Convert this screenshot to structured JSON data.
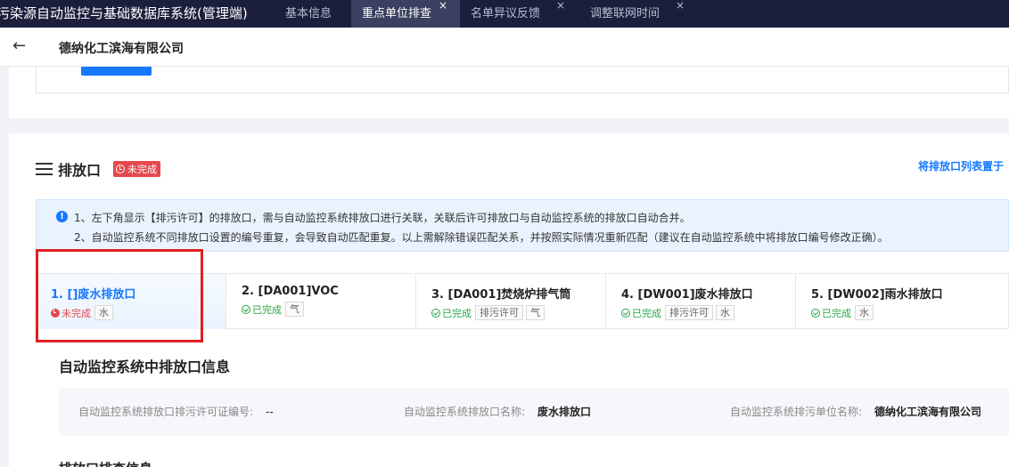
{
  "app": {
    "title": "污染源自动监控与基础数据库系统(管理端)"
  },
  "tabs": [
    {
      "label": "基本信息",
      "closable": false,
      "active": false
    },
    {
      "label": "重点单位排查",
      "closable": true,
      "active": true
    },
    {
      "label": "名单异议反馈",
      "closable": true,
      "active": false
    },
    {
      "label": "调整联网时间",
      "closable": true,
      "active": false
    }
  ],
  "header": {
    "back_icon": "arrow-left-icon",
    "company": "德纳化工滨海有限公司"
  },
  "section": {
    "title": "排放口",
    "status": "未完成",
    "top_link": "将排放口列表置于"
  },
  "notice": {
    "line1": "1、左下角显示【排污许可】的排放口，需与自动监控系统排放口进行关联，关联后许可排放口与自动监控系统的排放口自动合并。",
    "line2": "2、自动监控系统不同排放口设置的编号重复，会导致自动匹配重复。以上需解除错误匹配关系，并按照实际情况重新匹配（建议在自动监控系统中将排放口编号修改正确）。"
  },
  "outlets": [
    {
      "title": "1. []废水排放口",
      "status": "未完成",
      "status_type": "pending",
      "tags": [
        "水"
      ]
    },
    {
      "title": "2. [DA001]VOC",
      "status": "已完成",
      "status_type": "done",
      "tags": [
        "气"
      ]
    },
    {
      "title": "3. [DA001]焚烧炉排气筒",
      "status": "已完成",
      "status_type": "done",
      "tags": [
        "排污许可",
        "气"
      ]
    },
    {
      "title": "4. [DW001]废水排放口",
      "status": "已完成",
      "status_type": "done",
      "tags": [
        "排污许可",
        "水"
      ]
    },
    {
      "title": "5. [DW002]雨水排放口",
      "status": "已完成",
      "status_type": "done",
      "tags": [
        "水"
      ]
    }
  ],
  "detail": {
    "title": "自动监控系统中排放口信息",
    "permit_label": "自动监控系统排放口排污许可证编号:",
    "permit_value": "--",
    "name_label": "自动监控系统排放口名称:",
    "name_value": "废水排放口",
    "unit_label": "自动监控系统排污单位名称:",
    "unit_value": "德纳化工滨海有限公司",
    "next_title": "排放口排查信息"
  },
  "colors": {
    "topbar": "#1b1f3b",
    "accent": "#1677ff",
    "danger": "#e5484d",
    "success": "#28a745",
    "highlight": "#e02020"
  }
}
